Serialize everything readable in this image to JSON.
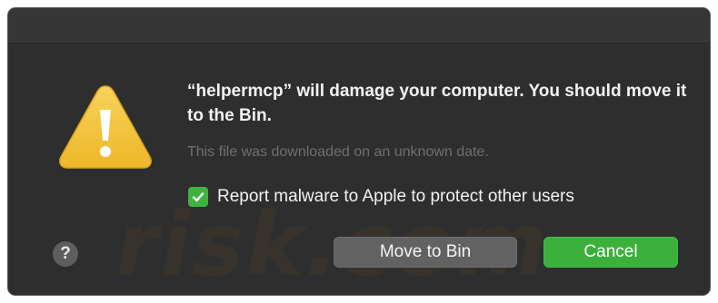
{
  "dialog": {
    "headline": "“helpermcp” will damage your computer. You should move it to the Bin.",
    "subtext": "This file was downloaded on an unknown date.",
    "checkbox": {
      "label": "Report malware to Apple to protect other users",
      "checked": true
    },
    "help_label": "?",
    "buttons": {
      "move_label": "Move to Bin",
      "cancel_label": "Cancel"
    }
  },
  "watermark": {
    "text": "risk.com"
  },
  "icons": {
    "warning": "warning-triangle-icon",
    "check": "checkmark-icon"
  },
  "colors": {
    "dialog_background": "#2e2e2e",
    "accent_green": "#3bb03b",
    "warning_yellow": "#f3c53a",
    "secondary_button": "#626262"
  }
}
